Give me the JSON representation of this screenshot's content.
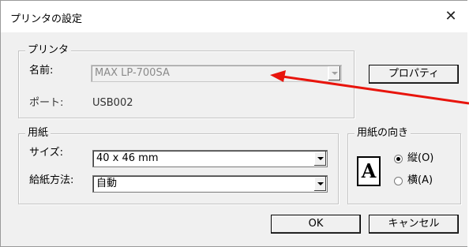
{
  "window": {
    "title": "プリンタの設定",
    "close_glyph": "✕"
  },
  "printer_group": {
    "legend": "プリンタ",
    "name_label": "名前:",
    "name_value": "MAX LP-700SA",
    "port_label": "ポート:",
    "port_value": "USB002",
    "properties_button": "プロパティ"
  },
  "paper_group": {
    "legend": "用紙",
    "size_label": "サイズ:",
    "size_value": "40 x 46 mm",
    "feed_label": "給紙方法:",
    "feed_value": "自動"
  },
  "orientation_group": {
    "legend": "用紙の向き",
    "icon_letter": "A",
    "portrait_label": "縦(O)",
    "landscape_label": "横(A)",
    "selected": "portrait"
  },
  "buttons": {
    "ok": "OK",
    "cancel": "キャンセル"
  },
  "annotation": {
    "arrow_color": "#e8140c"
  }
}
